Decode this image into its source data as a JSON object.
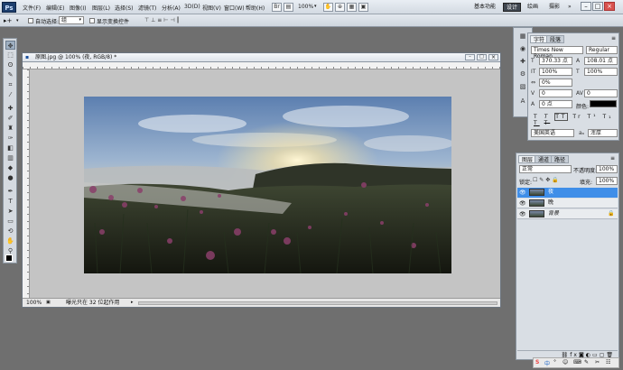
{
  "menubar": {
    "items": [
      "文件(F)",
      "编辑(E)",
      "图像(I)",
      "图层(L)",
      "选择(S)",
      "滤镜(T)",
      "分析(A)",
      "3D(D)",
      "视图(V)",
      "窗口(W)",
      "帮助(H)"
    ],
    "zoom": "100%",
    "workspace": {
      "basic": "基本功能",
      "design": "设计",
      "painting": "绘画",
      "photography": "摄影",
      "more": "»"
    },
    "window_controls": {
      "minimize": "–",
      "restore": "□",
      "close": "×"
    }
  },
  "options": {
    "auto_select_label": "自动选择:",
    "auto_select_value": "组",
    "transform_label": "显示变换控件"
  },
  "document": {
    "title": "原图.jpg @ 100% (夜, RGB/8) *",
    "zoom": "100%",
    "status": "曝光只在 32 位起作用"
  },
  "character": {
    "tabs": [
      "字符",
      "段落"
    ],
    "font_family": "Times New Roman",
    "font_style": "Regular",
    "font_size": "370.33 点",
    "leading": "108.01 点",
    "vertical_scale": "100%",
    "horizontal_scale": "100%",
    "tracking_pct": "0%",
    "kerning": "0",
    "tracking": "0",
    "baseline": "0 点",
    "color_label": "颜色:",
    "color": "#000000",
    "style_buttons": [
      "T",
      "T",
      "TT",
      "Tr",
      "T¹",
      "T₁",
      "T",
      "T"
    ],
    "language": "美国英语",
    "aa_label": "aₐ",
    "antialias": "浑厚"
  },
  "layers": {
    "tabs": [
      "图层",
      "通道",
      "路径"
    ],
    "blend_mode": "正常",
    "opacity_label": "不透明度:",
    "opacity": "100%",
    "lock_label": "锁定:",
    "fill_label": "填充:",
    "fill": "100%",
    "items": [
      {
        "name": "夜",
        "selected": true
      },
      {
        "name": "晚",
        "selected": false
      },
      {
        "name": "背景",
        "selected": false
      }
    ]
  },
  "taskbar": {
    "items": [
      "S",
      "中",
      "°",
      "☺",
      "⌨",
      "✎",
      "✂",
      "☷"
    ]
  },
  "colors": {
    "accent": "#3f8ee8",
    "canvas_bg": "#c4c4c4",
    "workspace_bg": "#6f6f6f"
  }
}
